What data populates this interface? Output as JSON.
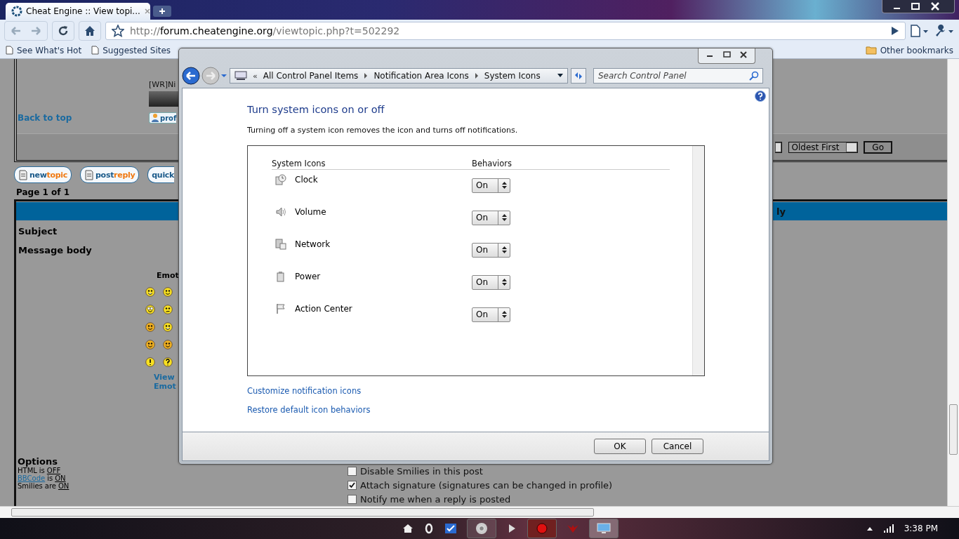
{
  "browser": {
    "tab_title": "Cheat Engine :: View topi...",
    "url_scheme": "http://",
    "url_host": "forum.cheatengine.org",
    "url_path": "/viewtopic.php?t=502292",
    "bookmarks": [
      "See What's Hot",
      "Suggested Sites"
    ],
    "other_bookmarks": "Other bookmarks"
  },
  "forum": {
    "poster": "[WR]Ni",
    "back_to_top": "Back to top",
    "profile_button": "prof",
    "sort_order": "Oldest First",
    "go_button": "Go",
    "action_buttons": [
      {
        "kind": "icon",
        "first": "new",
        "second": "topic"
      },
      {
        "kind": "icon",
        "first": "post",
        "second": "reply"
      },
      {
        "kind": "plain",
        "first": "quick"
      }
    ],
    "page_info": "Page 1 of 1",
    "header_bar": "ly",
    "subject_label": "Subject",
    "message_label": "Message body",
    "emoticons_heading": "Emot",
    "emoticon_links": [
      "View",
      "Emot"
    ],
    "options_title": "Options",
    "options": [
      {
        "subject": "HTML",
        "subject_link": false,
        "verb": "is",
        "value": "OFF"
      },
      {
        "subject": "BBCode",
        "subject_link": true,
        "verb": "is",
        "value": "ON"
      },
      {
        "subject": "Smilies",
        "subject_link": false,
        "verb": "are",
        "value": "ON"
      }
    ],
    "checkboxes": [
      {
        "label": "Disable Smilies in this post",
        "checked": false
      },
      {
        "label": "Attach signature (signatures can be changed in profile)",
        "checked": true
      },
      {
        "label": "Notify me when a reply is posted",
        "checked": false
      }
    ]
  },
  "dialog": {
    "overflow_chevron": "«",
    "breadcrumb": [
      "All Control Panel Items",
      "Notification Area Icons",
      "System Icons"
    ],
    "search": {
      "placeholder": "Search Control Panel"
    },
    "heading": "Turn system icons on or off",
    "description": "Turning off a system icon removes the icon and turns off notifications.",
    "columns": [
      "System Icons",
      "Behaviors"
    ],
    "rows": [
      {
        "name": "Clock",
        "behavior": "On"
      },
      {
        "name": "Volume",
        "behavior": "On"
      },
      {
        "name": "Network",
        "behavior": "On"
      },
      {
        "name": "Power",
        "behavior": "On"
      },
      {
        "name": "Action Center",
        "behavior": "On"
      }
    ],
    "links": [
      "Customize notification icons",
      "Restore default icon behaviors"
    ],
    "buttons": [
      "OK",
      "Cancel"
    ]
  },
  "taskbar": {
    "clock": "3:38 PM"
  }
}
